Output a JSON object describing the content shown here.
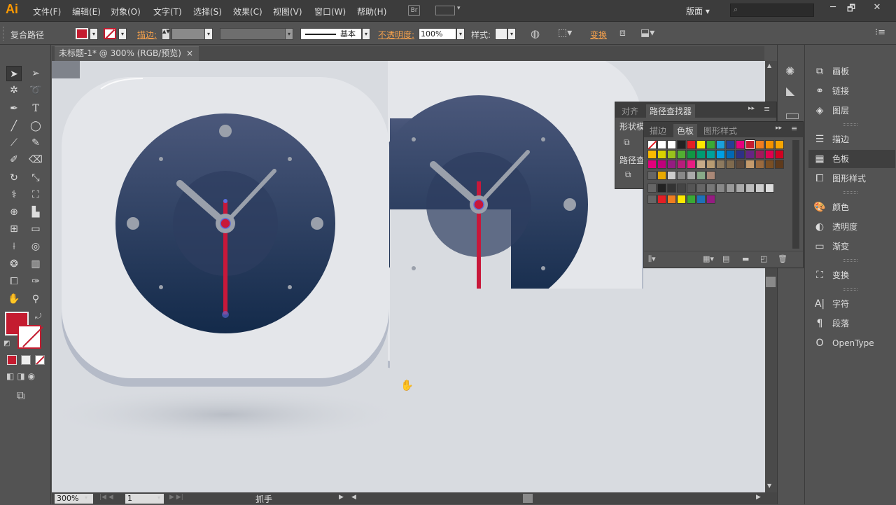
{
  "app": {
    "logo": "Ai",
    "menu": [
      "文件(F)",
      "编辑(E)",
      "对象(O)",
      "文字(T)",
      "选择(S)",
      "效果(C)",
      "视图(V)",
      "窗口(W)",
      "帮助(H)"
    ],
    "bridge": "Br",
    "workspace": "版面",
    "window_controls": [
      "─",
      "🗗",
      "✕"
    ]
  },
  "control": {
    "selection": "复合路径",
    "stroke_label": "描边:",
    "stroke_style": "基本",
    "opacity_label": "不透明度:",
    "opacity": "100%",
    "style_label": "样式:",
    "transform": "变换"
  },
  "document": {
    "tab_title": "未标题-1* @ 300% (RGB/预览)",
    "close": "×"
  },
  "status": {
    "zoom": "300%",
    "page": "1",
    "tool": "抓手"
  },
  "panels": {
    "pathfinder": {
      "tabs": [
        "对齐",
        "路径查找器"
      ],
      "row1": "形状模",
      "row2": "路径查"
    },
    "swatches": {
      "tabs": [
        "描边",
        "色板",
        "图形样式"
      ]
    }
  },
  "dock": {
    "items": [
      "画板",
      "链接",
      "图层",
      "描边",
      "色板",
      "图形样式",
      "颜色",
      "透明度",
      "渐变",
      "变换",
      "字符",
      "段落",
      "OpenType"
    ]
  },
  "colors": {
    "accent": "#c41c30",
    "canvas": "#d8dbe0",
    "clock_top": "#4b587b",
    "clock_bottom": "#132a4a",
    "hand": "#9aa0ab",
    "red_hand": "#c8183a"
  },
  "icons": [
    "selection-arrow-icon",
    "direct-selection-icon",
    "magic-wand-icon",
    "lasso-icon",
    "pen-icon",
    "type-icon",
    "line-icon",
    "ellipse-icon",
    "brush-icon",
    "pencil-icon",
    "blob-brush-icon",
    "eraser-icon",
    "rotate-icon",
    "scale-icon",
    "warp-icon",
    "free-transform-icon",
    "shape-builder-icon",
    "perspective-icon",
    "mesh-icon",
    "gradient-icon",
    "eyedropper-icon",
    "blend-icon",
    "symbol-sprayer-icon",
    "graph-icon",
    "artboard-icon",
    "slice-icon",
    "hand-icon",
    "zoom-icon"
  ]
}
